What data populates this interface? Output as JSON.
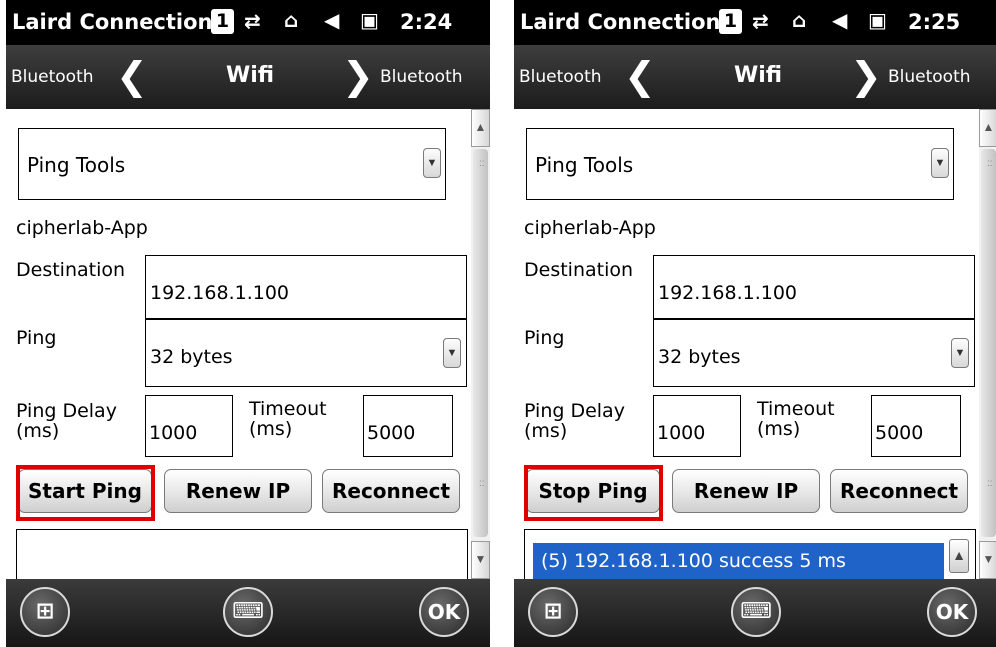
{
  "screens": [
    {
      "status": {
        "title": "Laird Connection",
        "notification": "1",
        "time": "2:24"
      },
      "nav": {
        "prev_label": "Bluetooth",
        "current_label": "Wifi",
        "next_label": "Bluetooth"
      },
      "tool_select": "Ping Tools",
      "profile": "cipherlab-App",
      "destination_label": "Destination",
      "destination_value": "192.168.1.100",
      "ping_label": "Ping",
      "ping_size": "32 bytes",
      "ping_delay_label_1": "Ping Delay",
      "ping_delay_label_2": "(ms)",
      "ping_delay_value": "1000",
      "timeout_label_1": "Timeout",
      "timeout_label_2": "(ms)",
      "timeout_value": "5000",
      "buttons": {
        "ping": "Start Ping",
        "renew": "Renew IP",
        "reconnect": "Reconnect"
      },
      "log": "",
      "softkeys": {
        "ok": "OK"
      }
    },
    {
      "status": {
        "title": "Laird Connection",
        "notification": "1",
        "time": "2:25"
      },
      "nav": {
        "prev_label": "Bluetooth",
        "current_label": "Wifi",
        "next_label": "Bluetooth"
      },
      "tool_select": "Ping Tools",
      "profile": "cipherlab-App",
      "destination_label": "Destination",
      "destination_value": "192.168.1.100",
      "ping_label": "Ping",
      "ping_size": "32 bytes",
      "ping_delay_label_1": "Ping Delay",
      "ping_delay_label_2": "(ms)",
      "ping_delay_value": "1000",
      "timeout_label_1": "Timeout",
      "timeout_label_2": "(ms)",
      "timeout_value": "5000",
      "buttons": {
        "ping": "Stop Ping",
        "renew": "Renew IP",
        "reconnect": "Reconnect"
      },
      "log": "(5) 192.168.1.100 success 5 ms",
      "softkeys": {
        "ok": "OK"
      }
    }
  ],
  "colors": {
    "highlight": "#e00000",
    "selection": "#1f62c8",
    "bar": "#000000"
  },
  "icons": [
    "notification-icon",
    "signal-sync-icon",
    "connection-icon",
    "volume-icon",
    "battery-icon",
    "windows-start-icon",
    "keyboard-icon"
  ]
}
